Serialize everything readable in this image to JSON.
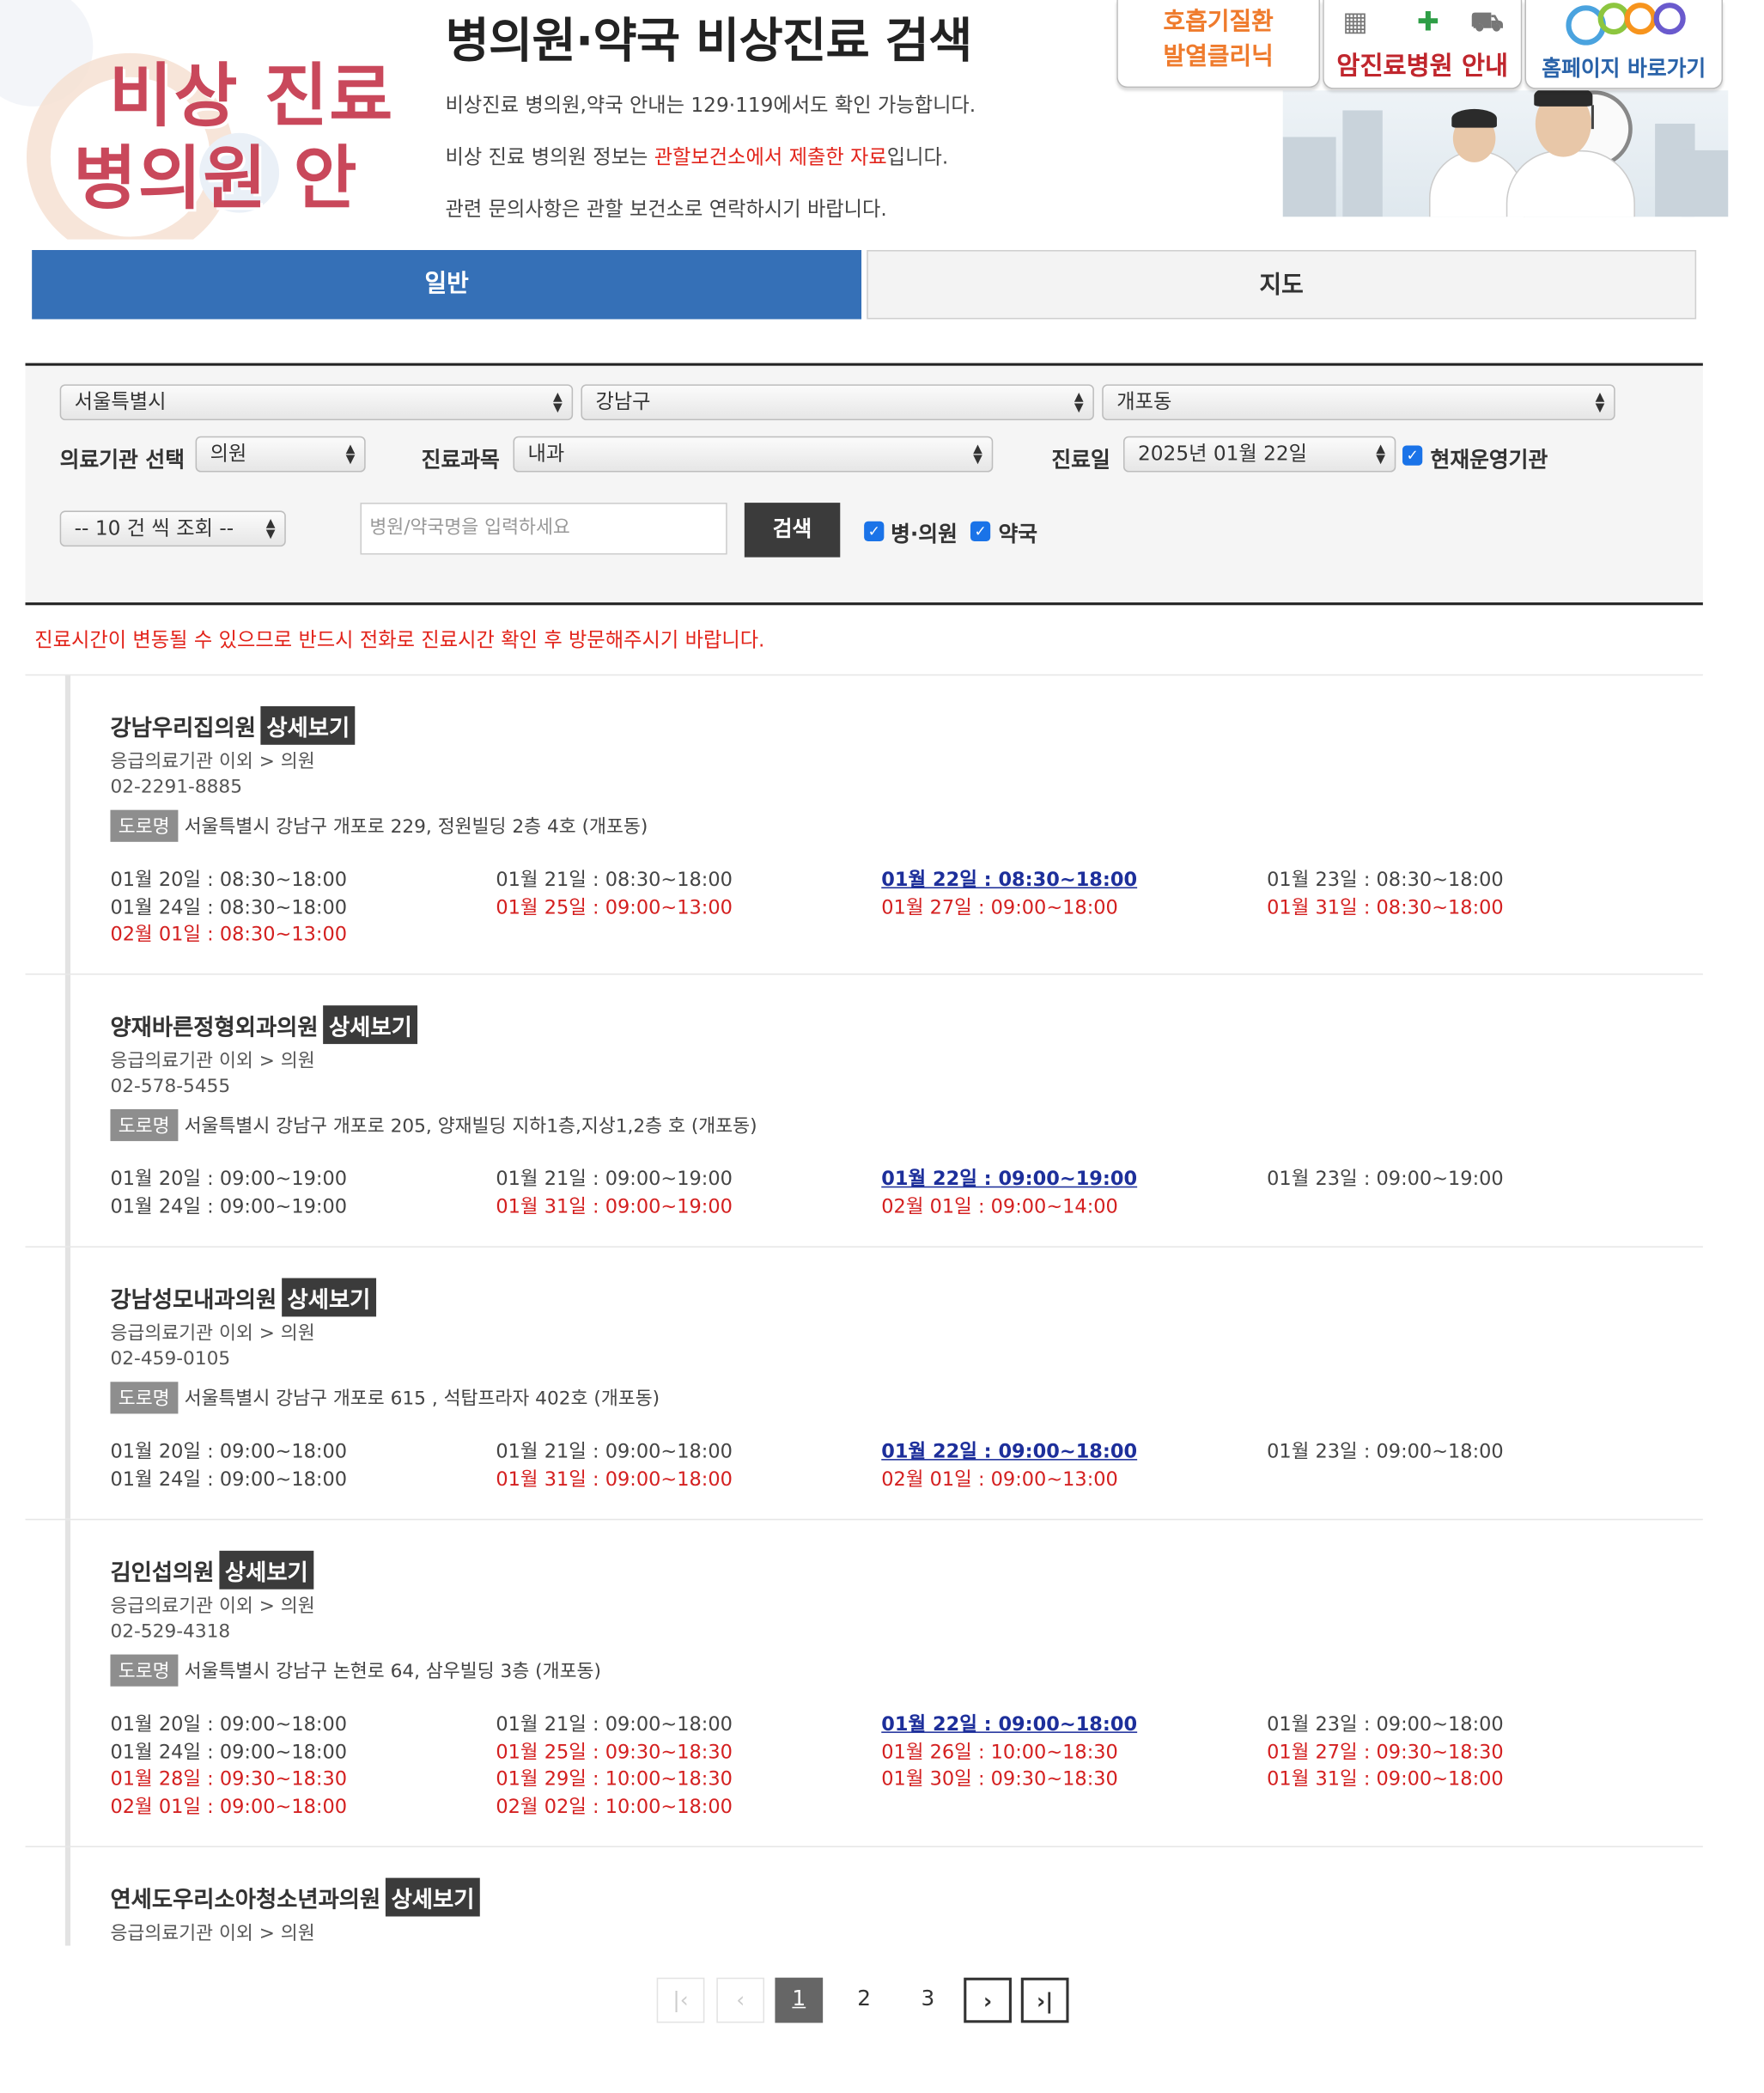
{
  "hero": {
    "line1": "비상 진료",
    "line2": "병의원 안내"
  },
  "page_title": "병의원·약국 비상진료 검색",
  "notices": {
    "n1": "비상진료 병의원,약국 안내는 129·119에서도 확인 가능합니다.",
    "n2_pre": "비상 진료 병의원 정보는 ",
    "n2_red": "관할보건소에서 제출한 자료",
    "n2_post": "입니다.",
    "n3": "관련 문의사항은 관할 보건소로 연락하시기 바랍니다."
  },
  "banners": {
    "respiratory_line1": "호흡기질환",
    "respiratory_line2": "발열클리닉",
    "cancer": "암진료병원 안내",
    "homepage": "홈페이지 바로가기"
  },
  "tabs": {
    "general": "일반",
    "map": "지도"
  },
  "search": {
    "city": "서울특별시",
    "district": "강남구",
    "dong": "개포동",
    "institution_label": "의료기관 선택",
    "institution_value": "의원",
    "department_label": "진료과목",
    "department_value": "내과",
    "date_label": "진료일",
    "date_value": "2025년 01월 22일",
    "current_open_label": "현재운영기관",
    "page_size": "-- 10 건 씩 조회 --",
    "placeholder": "병원/약국명을 입력하세요",
    "button": "검색",
    "hospital_check": "병·의원",
    "pharmacy_check": "약국"
  },
  "warning": "진료시간이 변동될 수 있으므로 반드시 전화로 진료시간 확인 후 방문해주시기 바랍니다.",
  "detail_label": "상세보기",
  "road_label": "도로명",
  "results": [
    {
      "name": "강남우리집의원",
      "category": "응급의료기관 이외 > 의원",
      "phone": "02-2291-8885",
      "address": "서울특별시 강남구 개포로 229, 정원빌딩 2층 4호 (개포동)",
      "schedule": [
        {
          "text": "01월 20일 : 08:30~18:00",
          "kind": "normal"
        },
        {
          "text": "01월 21일 : 08:30~18:00",
          "kind": "normal"
        },
        {
          "text": "01월 22일 : 08:30~18:00",
          "kind": "today"
        },
        {
          "text": "01월 23일 : 08:30~18:00",
          "kind": "normal"
        },
        {
          "text": "01월 24일 : 08:30~18:00",
          "kind": "normal"
        },
        {
          "text": "01월 25일 : 09:00~13:00",
          "kind": "holiday"
        },
        {
          "text": "01월 27일 : 09:00~18:00",
          "kind": "holiday"
        },
        {
          "text": "01월 31일 : 08:30~18:00",
          "kind": "holiday"
        },
        {
          "text": "02월 01일 : 08:30~13:00",
          "kind": "holiday"
        }
      ]
    },
    {
      "name": "양재바른정형외과의원",
      "category": "응급의료기관 이외 > 의원",
      "phone": "02-578-5455",
      "address": "서울특별시 강남구 개포로 205, 양재빌딩 지하1층,지상1,2층 호 (개포동)",
      "schedule": [
        {
          "text": "01월 20일 : 09:00~19:00",
          "kind": "normal"
        },
        {
          "text": "01월 21일 : 09:00~19:00",
          "kind": "normal"
        },
        {
          "text": "01월 22일 : 09:00~19:00",
          "kind": "today"
        },
        {
          "text": "01월 23일 : 09:00~19:00",
          "kind": "normal"
        },
        {
          "text": "01월 24일 : 09:00~19:00",
          "kind": "normal"
        },
        {
          "text": "01월 31일 : 09:00~19:00",
          "kind": "holiday"
        },
        {
          "text": "02월 01일 : 09:00~14:00",
          "kind": "holiday"
        }
      ]
    },
    {
      "name": "강남성모내과의원",
      "category": "응급의료기관 이외 > 의원",
      "phone": "02-459-0105",
      "address": "서울특별시 강남구 개포로 615 , 석탑프라자 402호 (개포동)",
      "schedule": [
        {
          "text": "01월 20일 : 09:00~18:00",
          "kind": "normal"
        },
        {
          "text": "01월 21일 : 09:00~18:00",
          "kind": "normal"
        },
        {
          "text": "01월 22일 : 09:00~18:00",
          "kind": "today"
        },
        {
          "text": "01월 23일 : 09:00~18:00",
          "kind": "normal"
        },
        {
          "text": "01월 24일 : 09:00~18:00",
          "kind": "normal"
        },
        {
          "text": "01월 31일 : 09:00~18:00",
          "kind": "holiday"
        },
        {
          "text": "02월 01일 : 09:00~13:00",
          "kind": "holiday"
        }
      ]
    },
    {
      "name": "김인섭의원",
      "category": "응급의료기관 이외 > 의원",
      "phone": "02-529-4318",
      "address": "서울특별시 강남구 논현로 64, 삼우빌딩 3층 (개포동)",
      "schedule": [
        {
          "text": "01월 20일 : 09:00~18:00",
          "kind": "normal"
        },
        {
          "text": "01월 21일 : 09:00~18:00",
          "kind": "normal"
        },
        {
          "text": "01월 22일 : 09:00~18:00",
          "kind": "today"
        },
        {
          "text": "01월 23일 : 09:00~18:00",
          "kind": "normal"
        },
        {
          "text": "01월 24일 : 09:00~18:00",
          "kind": "normal"
        },
        {
          "text": "01월 25일 : 09:30~18:30",
          "kind": "holiday"
        },
        {
          "text": "01월 26일 : 10:00~18:30",
          "kind": "holiday"
        },
        {
          "text": "01월 27일 : 09:30~18:30",
          "kind": "holiday"
        },
        {
          "text": "01월 28일 : 09:30~18:30",
          "kind": "holiday"
        },
        {
          "text": "01월 29일 : 10:00~18:30",
          "kind": "holiday"
        },
        {
          "text": "01월 30일 : 09:30~18:30",
          "kind": "holiday"
        },
        {
          "text": "01월 31일 : 09:00~18:00",
          "kind": "holiday"
        },
        {
          "text": "02월 01일 : 09:00~18:00",
          "kind": "holiday"
        },
        {
          "text": "02월 02일 : 10:00~18:00",
          "kind": "holiday"
        }
      ]
    },
    {
      "name": "연세도우리소아청소년과의원",
      "category": "응급의료기관 이외 > 의원",
      "phone": "",
      "address": "",
      "schedule": []
    }
  ],
  "pagination": {
    "pages": [
      "1",
      "2",
      "3"
    ],
    "current": "1"
  },
  "colors": {
    "tab_active": "#3570b7",
    "alert_red": "#e2231a",
    "today_blue": "#1d2f9b",
    "hero_pink": "#c9485b"
  }
}
